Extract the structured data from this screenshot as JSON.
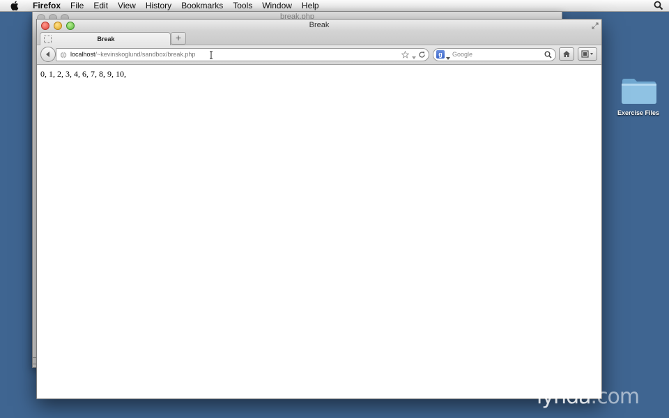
{
  "menubar": {
    "app": "Firefox",
    "items": [
      "File",
      "Edit",
      "View",
      "History",
      "Bookmarks",
      "Tools",
      "Window",
      "Help"
    ]
  },
  "background_window": {
    "title": "break.php"
  },
  "window": {
    "title": "Break",
    "tab": {
      "label": "Break"
    },
    "new_tab_label": "+",
    "url": {
      "host": "localhost",
      "path": "/~kevinskoglund/sandbox/break.php"
    },
    "search": {
      "engine_letter": "g",
      "placeholder": "Google"
    },
    "page_output": "0, 1, 2, 3, 4, 6, 7, 8, 9, 10,"
  },
  "desktop": {
    "folder_label": "Exercise Files"
  },
  "watermark": {
    "brand": "lynda",
    "suffix": ".com"
  },
  "colors": {
    "desktop": "#3f6591",
    "close": "#e0443a",
    "minimize": "#e0a925",
    "maximize": "#58b83a",
    "folder": "#8fc2e3"
  },
  "icons": [
    "apple-icon",
    "spotlight-icon",
    "fullscreen-icon",
    "back-arrow-icon",
    "globe-icon",
    "text-cursor-icon",
    "bookmark-star-icon",
    "history-dropdown-icon",
    "reload-icon",
    "google-icon",
    "search-dropdown-icon",
    "magnifier-icon",
    "home-icon",
    "bookmarks-icon",
    "folder-icon"
  ]
}
